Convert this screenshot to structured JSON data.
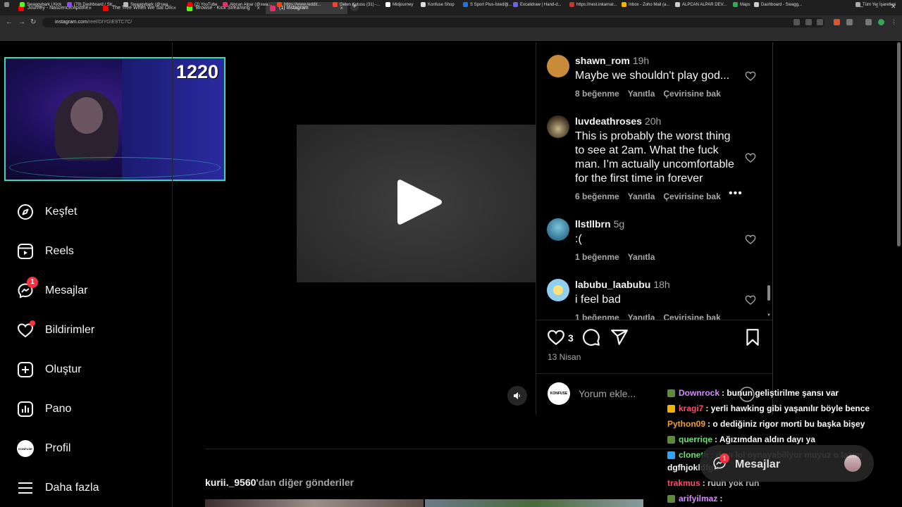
{
  "browser": {
    "tabs": [
      {
        "title": "Journey - Nascence/Apotheosis",
        "color": "#ff0000"
      },
      {
        "title": "The Tree When We Sat Once - ...",
        "color": "#ff0000"
      },
      {
        "title": "Browse - Kick Streaming",
        "color": "#53fc18"
      },
      {
        "title": "(1) Instagram",
        "color": "#e1306c"
      }
    ],
    "url_host": "instagram.com",
    "url_path": "/reel/DIYGIE9TC7C/",
    "bookmarks": [
      {
        "label": "Swaggybark | Kick",
        "color": "#53fc18"
      },
      {
        "label": "(79) Dashboard / Str...",
        "color": "#9146ff"
      },
      {
        "label": "Swaggybark (@swa...",
        "color": "#bbbbbb"
      },
      {
        "label": "(2) YouTube",
        "color": "#ff0000"
      },
      {
        "label": "Alpcan Alpar (@swa...",
        "color": "#e1306c"
      },
      {
        "label": "https://www.reddit...",
        "color": "#ff4500"
      },
      {
        "label": "Gelen Kutusu (31) -...",
        "color": "#ea4335"
      },
      {
        "label": "Midjourney",
        "color": "#ffffff"
      },
      {
        "label": "Konfuse Shop",
        "color": "#dddddd"
      },
      {
        "label": "S Sport Plus-İstediği...",
        "color": "#1a73e8"
      },
      {
        "label": "Excalidraw | Hand-d...",
        "color": "#6965db"
      },
      {
        "label": "https://nest.inkarnat...",
        "color": "#c0392b"
      },
      {
        "label": "Inbox - Zoho Mail (a...",
        "color": "#f4b400"
      },
      {
        "label": "ALPCAN ALPAR DEV...",
        "color": "#cccccc"
      },
      {
        "label": "Maps",
        "color": "#34a853"
      },
      {
        "label": "Dashboard - Swagg...",
        "color": "#cccccc"
      }
    ],
    "all_bookmarks": "Tüm Yer İşaretleri"
  },
  "stream": {
    "counter": "1220"
  },
  "nav": {
    "explore": "Keşfet",
    "reels": "Reels",
    "messages": "Mesajlar",
    "messages_badge": "1",
    "notifications": "Bildirimler",
    "create": "Oluştur",
    "dashboard": "Pano",
    "profile": "Profil",
    "profile_avatar": "KONFUSE",
    "more": "Daha fazla"
  },
  "comments": [
    {
      "user": "shawn_rom",
      "time": "19h",
      "text": "Maybe we shouldn't play god...",
      "likes": "8 beğenme",
      "reply": "Yanıtla",
      "translate": "Çevirisine bak",
      "avatar_color": "#c78b3a"
    },
    {
      "user": "luvdeathroses",
      "time": "20h",
      "text": "This is probably the worst thing to see at 2am. What the fuck man. I’m actually uncomfortable for the first time in forever",
      "likes": "6 beğenme",
      "reply": "Yanıtla",
      "translate": "Çevirisine bak",
      "avatar_color": "#6b5a3e"
    },
    {
      "user": "llstllbrn",
      "time": "5g",
      "text": ":(",
      "likes": "1 beğenme",
      "reply": "Yanıtla",
      "translate": "",
      "avatar_color": "#3d8fb3"
    },
    {
      "user": "labubu_laabubu",
      "time": "18h",
      "text": "i feel bad",
      "likes": "1 beğenme",
      "reply": "Yanıtla",
      "translate": "Çevirisine bak",
      "avatar_color": "#8fd0f0"
    }
  ],
  "post": {
    "like_count": "3",
    "date": "13 Nisan",
    "comment_placeholder": "Yorum ekle...",
    "my_avatar": "KONFUSE"
  },
  "more_posts": {
    "user": "kurii._9560",
    "suffix": "'dan diğer gönderiler"
  },
  "chat": [
    {
      "user": "Downrock",
      "msg": ": bunun geliştirilme şansı var",
      "color": "#d58cff",
      "badge": "#5f8a3a"
    },
    {
      "user": "kragi7",
      "msg": ": yerli hawking gibi yaşanılır böyle bence",
      "color": "#ff4d6a",
      "badge": "#f0b400"
    },
    {
      "user": "Python09",
      "msg": ": o dediğiniz rigor morti bu başka bişey",
      "color": "#f0a030",
      "badge": ""
    },
    {
      "user": "querriqe",
      "msg": ": Ağızımdan aldın dayı ya",
      "color": "#6ee07a",
      "badge": "#5f8a3a"
    },
    {
      "user": "cloneth",
      "msg": ": dayı lol oynayabiliyor muyuz o lazım",
      "color": "#6ee07a",
      "badge": "#2aa6ff"
    },
    {
      "user": "",
      "msg": "dgfhjokldfgh",
      "color": "#ffffff",
      "badge": ""
    },
    {
      "user": "trakmus",
      "msg": ": ruuh yok ruh",
      "color": "#ff4d6a",
      "badge": ""
    },
    {
      "user": "arifyilmaz",
      "msg": ":",
      "color": "#d58cff",
      "badge": "#5f8a3a"
    }
  ],
  "dm_pill": {
    "label": "Mesajlar",
    "badge": "1"
  }
}
